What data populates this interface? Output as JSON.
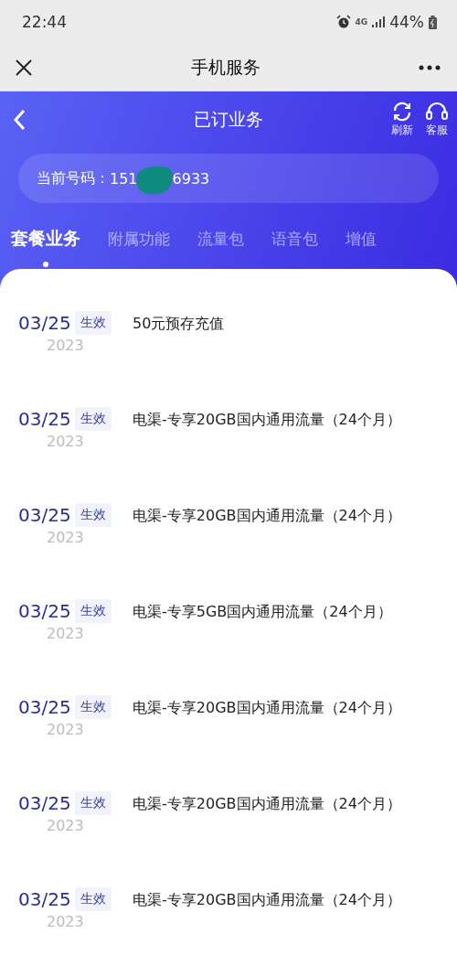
{
  "status_bar": {
    "time": "22:44",
    "network": "4G",
    "battery": "44%"
  },
  "header": {
    "title": "手机服务"
  },
  "page": {
    "title": "已订业务",
    "actions": [
      {
        "kind": "refresh",
        "label": "刷新"
      },
      {
        "kind": "service",
        "label": "客服"
      }
    ]
  },
  "number": {
    "label": "当前号码：",
    "start": "151",
    "end": "6933"
  },
  "tabs": [
    {
      "label": "套餐业务",
      "selected": true
    },
    {
      "label": "附属功能",
      "selected": false
    },
    {
      "label": "流量包",
      "selected": false
    },
    {
      "label": "语音包",
      "selected": false
    },
    {
      "label": "增值",
      "selected": false
    }
  ],
  "items": [
    {
      "date": "03/25",
      "year": "2023",
      "status": "生效",
      "name": "50元预存充值"
    },
    {
      "date": "03/25",
      "year": "2023",
      "status": "生效",
      "name": "电渠-专享20GB国内通用流量（24个月）"
    },
    {
      "date": "03/25",
      "year": "2023",
      "status": "生效",
      "name": "电渠-专享20GB国内通用流量（24个月）"
    },
    {
      "date": "03/25",
      "year": "2023",
      "status": "生效",
      "name": "电渠-专享5GB国内通用流量（24个月）"
    },
    {
      "date": "03/25",
      "year": "2023",
      "status": "生效",
      "name": "电渠-专享20GB国内通用流量（24个月）"
    },
    {
      "date": "03/25",
      "year": "2023",
      "status": "生效",
      "name": "电渠-专享20GB国内通用流量（24个月）"
    },
    {
      "date": "03/25",
      "year": "2023",
      "status": "生效",
      "name": "电渠-专享20GB国内通用流量（24个月）"
    }
  ]
}
